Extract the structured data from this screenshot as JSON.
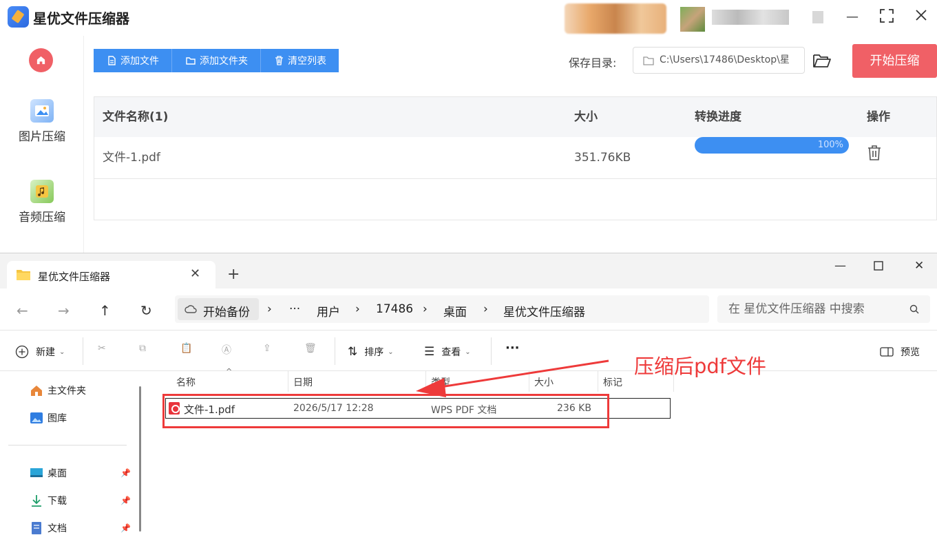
{
  "app": {
    "title": "星优文件压缩器",
    "sidebar": [
      {
        "label": "图片压缩"
      },
      {
        "label": "音频压缩"
      }
    ],
    "buttons": {
      "add_file": "添加文件",
      "add_folder": "添加文件夹",
      "clear_list": "清空列表",
      "start": "开始压缩"
    },
    "save": {
      "label": "保存目录:",
      "path": "C:\\Users\\17486\\Desktop\\星"
    },
    "table": {
      "headers": [
        "文件名称(1)",
        "大小",
        "转换进度",
        "操作"
      ],
      "rows": [
        {
          "name": "文件-1.pdf",
          "size": "351.76KB",
          "progress_label": "100%",
          "progress": 1.0
        }
      ]
    },
    "colors": {
      "accent_blue": "#3d8ff2",
      "accent_red": "#f06066"
    }
  },
  "explorer": {
    "tab_title": "星优文件压缩器",
    "breadcrumb": [
      "开始备份",
      "···",
      "用户",
      "17486",
      "桌面",
      "星优文件压缩器"
    ],
    "search_placeholder": "在 星优文件压缩器 中搜索",
    "toolbar": {
      "new": "新建",
      "sort": "排序",
      "view": "查看",
      "more": "···",
      "preview": "预览"
    },
    "nav": [
      {
        "label": "主文件夹",
        "icon": "home-icon"
      },
      {
        "label": "图库",
        "icon": "gallery-icon"
      },
      {
        "label": "桌面",
        "icon": "desktop-icon"
      },
      {
        "label": "下载",
        "icon": "download-icon"
      },
      {
        "label": "文档",
        "icon": "document-icon"
      }
    ],
    "columns": [
      "名称",
      "日期",
      "类型",
      "大小",
      "标记"
    ],
    "files": [
      {
        "name": "文件-1.pdf",
        "date": "2026/5/17 12:28",
        "type": "WPS PDF 文档",
        "size": "236 KB"
      }
    ]
  },
  "annotation": {
    "text": "压缩后pdf文件",
    "color": "#ee3a3a"
  }
}
